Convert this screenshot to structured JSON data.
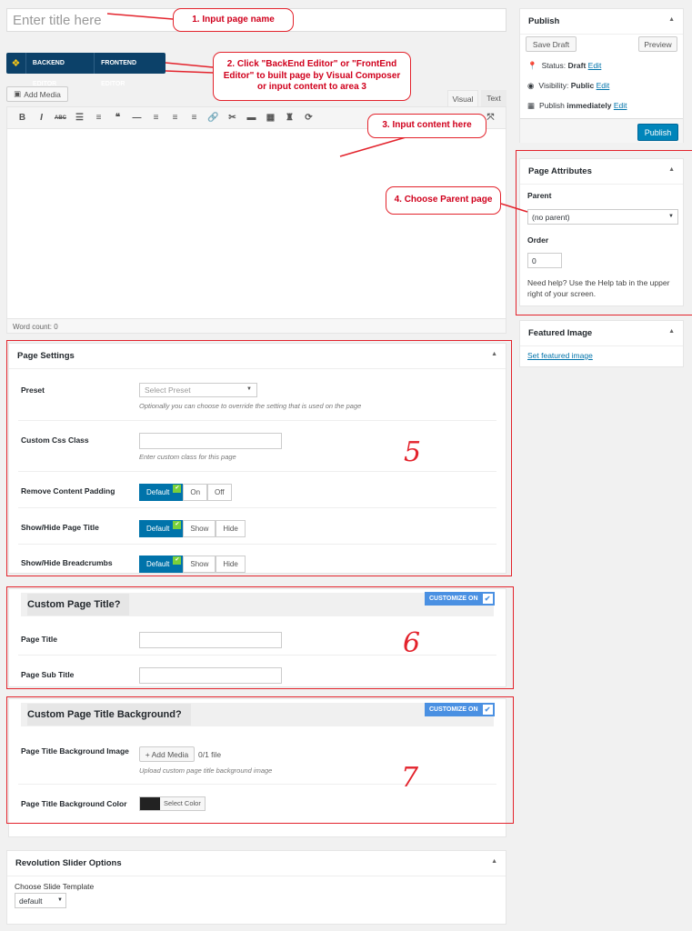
{
  "post": {
    "title_placeholder": "Enter title here",
    "word_count": "Word count: 0"
  },
  "vc": {
    "backend_label": "BACKEND EDITOR",
    "frontend_label": "FRONTEND EDITOR"
  },
  "editor": {
    "add_media_label": "Add Media",
    "tab_visual": "Visual",
    "tab_text": "Text",
    "toolbar_icons": [
      "bold-icon",
      "italic-icon",
      "strikethrough-icon",
      "bullet-list-icon",
      "numbered-list-icon",
      "blockquote-icon",
      "horizontal-rule-icon",
      "align-left-icon",
      "align-center-icon",
      "align-right-icon",
      "link-icon",
      "unlink-icon",
      "read-more-icon",
      "toolbar-toggle-icon",
      "vc-shortcode-icon",
      "refresh-icon"
    ]
  },
  "callouts": {
    "c1": "1. Input page name",
    "c2": "2. Click \"BackEnd Editor\" or \"FrontEnd Editor\" to built page by Visual Composer or input content to area 3",
    "c3": "3. Input content here",
    "c4": "4. Choose Parent page",
    "n5": "5",
    "n6": "6",
    "n7": "7"
  },
  "page_settings": {
    "title": "Page Settings",
    "preset_label": "Preset",
    "preset_value": "Select Preset",
    "preset_desc": "Optionally you can choose to override the setting that is used on the page",
    "css_label": "Custom Css Class",
    "css_desc": "Enter custom class for this page",
    "padding_label": "Remove Content Padding",
    "padding_opts": [
      "Default",
      "On",
      "Off"
    ],
    "ptitle_label": "Show/Hide Page Title",
    "ptitle_opts": [
      "Default",
      "Show",
      "Hide"
    ],
    "bread_label": "Show/Hide Breadcrumbs",
    "bread_opts": [
      "Default",
      "Show",
      "Hide"
    ]
  },
  "custom_title": {
    "heading": "Custom Page Title?",
    "customize_label": "CUSTOMIZE ON",
    "page_title_label": "Page Title",
    "sub_title_label": "Page Sub Title"
  },
  "custom_bg": {
    "heading": "Custom Page Title Background?",
    "customize_label": "CUSTOMIZE ON",
    "image_label": "Page Title Background Image",
    "add_media": "+ Add Media",
    "file_count": "0/1 file",
    "image_desc": "Upload custom page title background image",
    "color_label": "Page Title Background Color",
    "select_color": "Select Color",
    "color_swatch": "#222222"
  },
  "revslider": {
    "title": "Revolution Slider Options",
    "label": "Choose Slide Template",
    "value": "default"
  },
  "publish": {
    "title": "Publish",
    "save_draft": "Save Draft",
    "preview": "Preview",
    "status_label": "Status:",
    "status_value": "Draft",
    "visibility_label": "Visibility:",
    "visibility_value": "Public",
    "schedule_label": "Publish",
    "schedule_value": "immediately",
    "edit": "Edit",
    "publish_button": "Publish"
  },
  "attributes": {
    "title": "Page Attributes",
    "parent_label": "Parent",
    "parent_value": "(no parent)",
    "order_label": "Order",
    "order_value": "0",
    "help": "Need help? Use the Help tab in the upper right of your screen."
  },
  "featured": {
    "title": "Featured Image",
    "link": "Set featured image"
  },
  "colors": {
    "accent": "#0073aa",
    "annotation": "#e3232c",
    "vc_bar": "#0c4169"
  }
}
